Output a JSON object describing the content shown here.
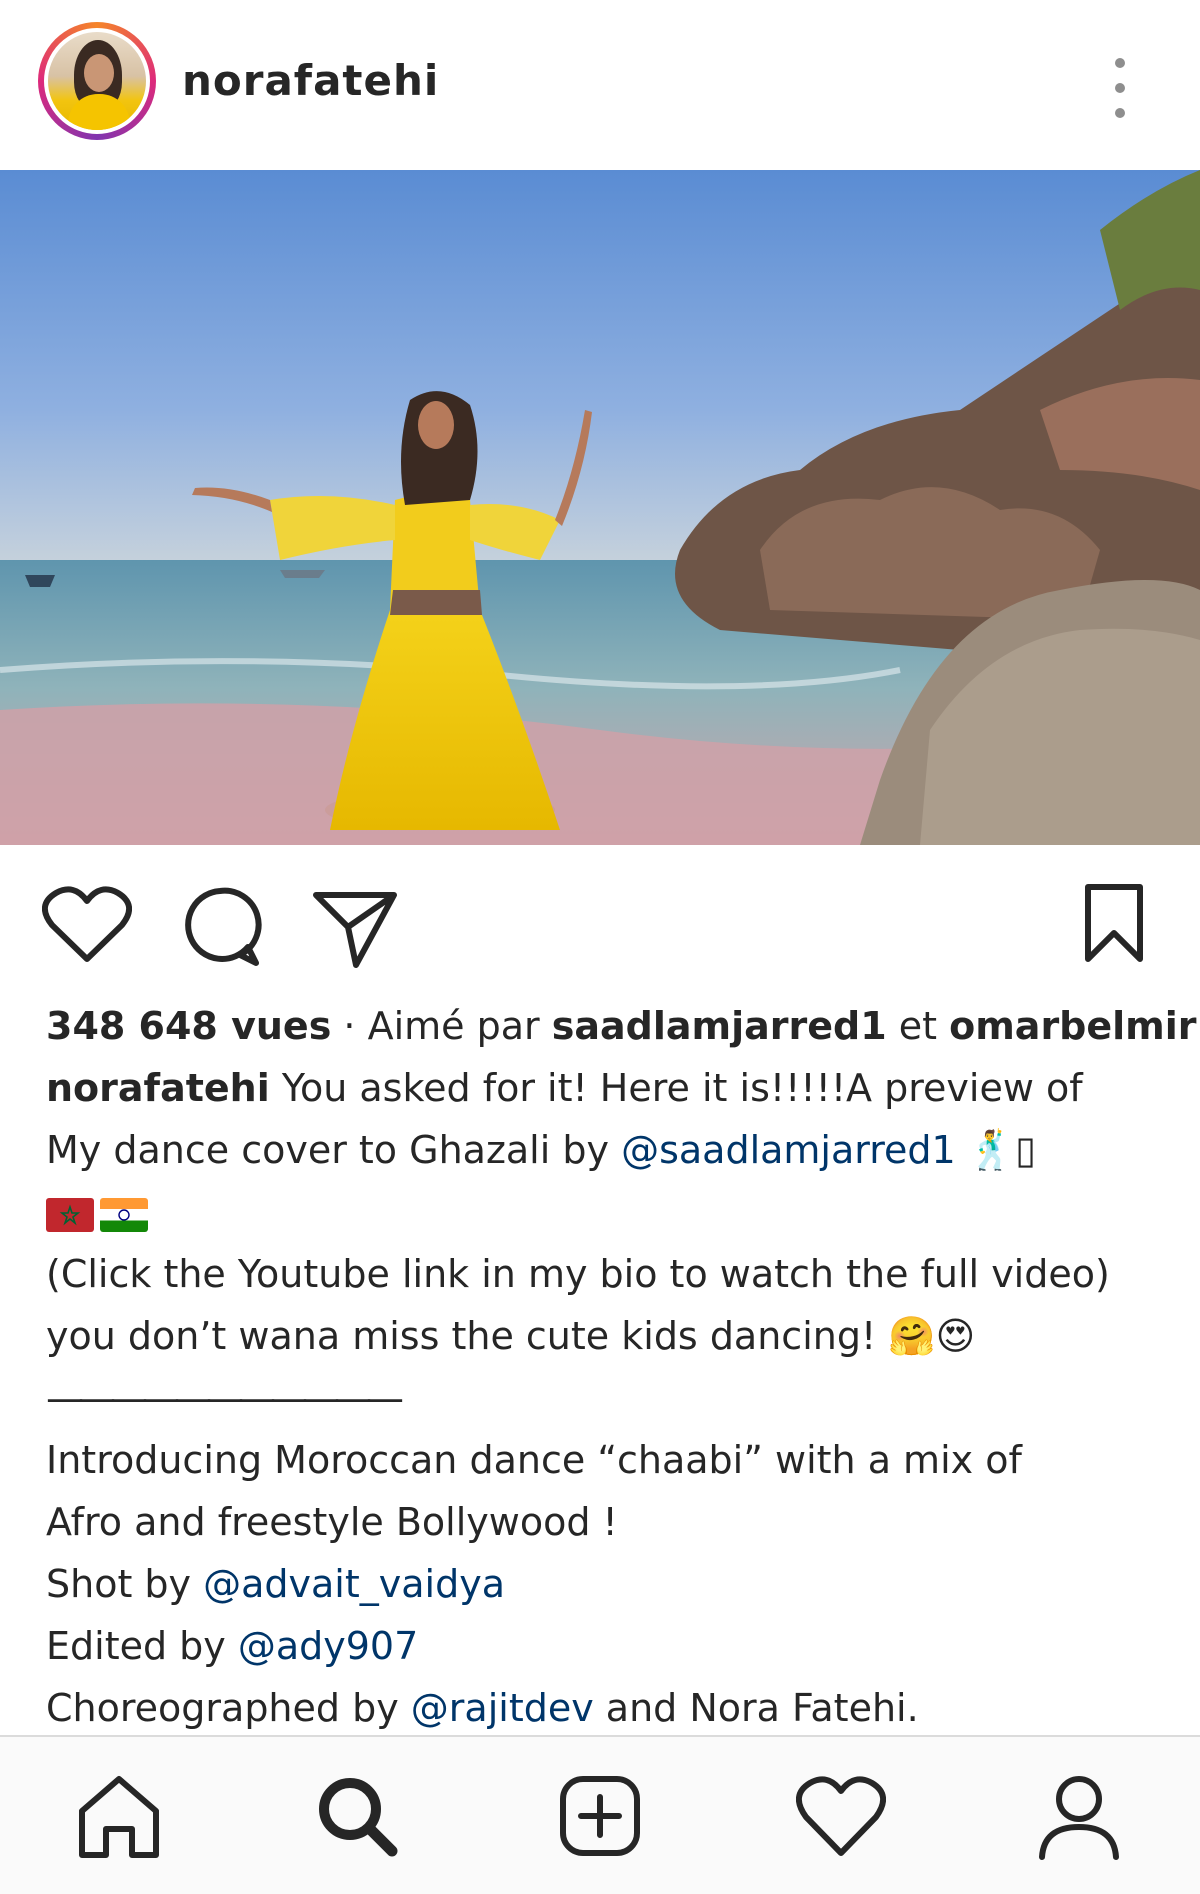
{
  "header": {
    "username": "norafatehi",
    "avatar_icon": "profile-avatar",
    "more_icon": "more-vertical-icon"
  },
  "actions": {
    "like_icon": "heart-icon",
    "comment_icon": "comment-icon",
    "share_icon": "send-icon",
    "save_icon": "bookmark-icon"
  },
  "stats": {
    "views": "348 648 vues",
    "separator": " · ",
    "liked_by_prefix": "Aimé par ",
    "liker_1": "saadlamjarred1",
    "and": " et ",
    "liker_2": "omarbelmir"
  },
  "caption": {
    "author": "norafatehi",
    "line1_text": " You asked for it! Here it is!!!!!A preview of",
    "line2_text": "My dance cover to Ghazali by ",
    "line2_mention": "@saadlamjarred1",
    "line2_tail": " 🕺▯",
    "line4": "(Click the Youtube link in my bio to watch the full video)",
    "line5": "you don’t wana miss the cute kids dancing! 🤗😍",
    "line6": "———————————",
    "line7": "Introducing Moroccan dance “chaabi” with a mix of",
    "line8": "Afro and freestyle Bollywood !",
    "line9_prefix": "Shot by ",
    "line9_mention": "@advait_vaidya",
    "line10_prefix": "Edited by ",
    "line10_mention": "@ady907",
    "line11_prefix": "Choreographed by ",
    "line11_mention": "@rajitdev",
    "line11_tail": " and Nora Fatehi."
  },
  "colors": {
    "text": "#262626",
    "mention": "#003569",
    "icon": "#262626",
    "ring_start": "#f58529",
    "ring_end": "#dd2a7b"
  },
  "bottom_nav": {
    "items": [
      "home-icon",
      "search-icon",
      "add-post-icon",
      "activity-heart-icon",
      "profile-icon"
    ]
  }
}
